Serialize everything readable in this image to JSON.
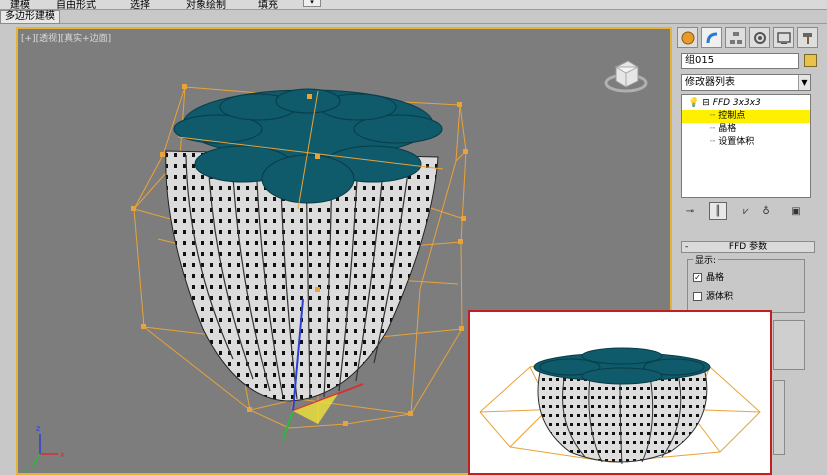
{
  "ribbon": {
    "tabs": [
      "建模",
      "自由形式",
      "选择",
      "对象绘制",
      "填充"
    ],
    "subtab": "多边形建模",
    "dropdown_glyph": "▾"
  },
  "viewport": {
    "label": "[+][透视][真实+边面]",
    "frame_color": "#e2b43a",
    "lattice_color": "#e8a33a",
    "cap_color": "#0f5a6b",
    "gizmo_axes": [
      "x",
      "y",
      "z"
    ]
  },
  "panel": {
    "tab_icons": [
      "sphere-icon",
      "bend-icon",
      "hierarchy-icon",
      "motion-icon",
      "display-icon",
      "hammer-icon"
    ],
    "object_name": "组015",
    "object_color": "#e8c24a",
    "modifier_list": "修改器列表",
    "stack": {
      "modifier": "FFD 3x3x3",
      "items": [
        "控制点",
        "晶格",
        "设置体积"
      ],
      "selected_index": 0
    },
    "toolbar_icons": [
      "pin-icon",
      "show-end-result-icon",
      "make-unique-icon",
      "remove-modifier-icon",
      "configure-sets-icon"
    ],
    "rollout": {
      "title": "FFD 参数",
      "display_group": "显示:",
      "lattice_label": "晶格",
      "lattice_checked": true,
      "source_volume_label": "源体积",
      "source_volume_checked": false
    }
  },
  "inset": {
    "border_color": "#c21f1f"
  }
}
